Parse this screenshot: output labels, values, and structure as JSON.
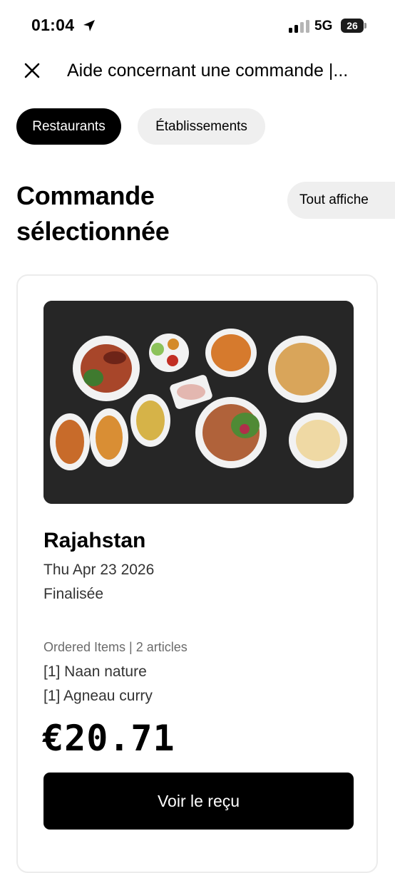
{
  "status_bar": {
    "time": "01:04",
    "network": "5G",
    "battery": "26"
  },
  "header": {
    "title": "Aide concernant une commande |..."
  },
  "filters": {
    "active": "Restaurants",
    "inactive": "Établissements"
  },
  "section": {
    "title_line1": "Commande",
    "title_line2": "sélectionnée",
    "show_all": "Tout affiche"
  },
  "order": {
    "restaurant": "Rajahstan",
    "date": "Thu Apr 23 2026",
    "status": "Finalisée",
    "items_header": "Ordered Items | 2 articles",
    "items": [
      "[1] Naan nature",
      "[1] Agneau curry"
    ],
    "total": "€20.71",
    "receipt_button": "Voir le reçu"
  },
  "colors": {
    "primary": "#000000",
    "chip_inactive_bg": "#efefef",
    "muted_text": "#6b6b6b",
    "image_background": "#262626"
  },
  "icons": [
    "location-arrow-icon",
    "signal-icon",
    "battery-icon",
    "close-icon"
  ]
}
